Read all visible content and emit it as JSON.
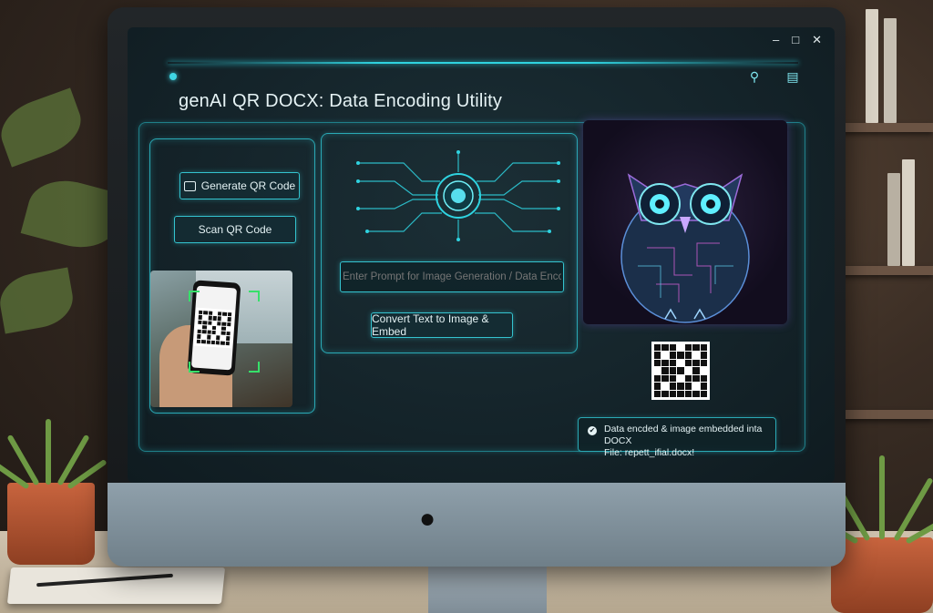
{
  "window": {
    "title": "genAI QR DOCX: Data Encoding Utility",
    "controls": {
      "minimize": "–",
      "maximize": "□",
      "close": "✕"
    },
    "toolbar_icons": [
      "search-icon",
      "chat-icon"
    ]
  },
  "left_panel": {
    "generate_label": "Generate QR Code",
    "scan_label": "Scan QR Code"
  },
  "center_panel": {
    "prompt_placeholder": "Enter Prompt for Image Generation / Data Encoding",
    "convert_label": "Convert Text to Image & Embed"
  },
  "right_panel": {
    "status_line1": "Data encded & image embedded inta DOCX",
    "status_line2": "File: repett_ifial.docx!"
  },
  "colors": {
    "accent": "#2fd3e0",
    "panel_border": "#2aa9b5",
    "screen_bg": "#142329"
  }
}
